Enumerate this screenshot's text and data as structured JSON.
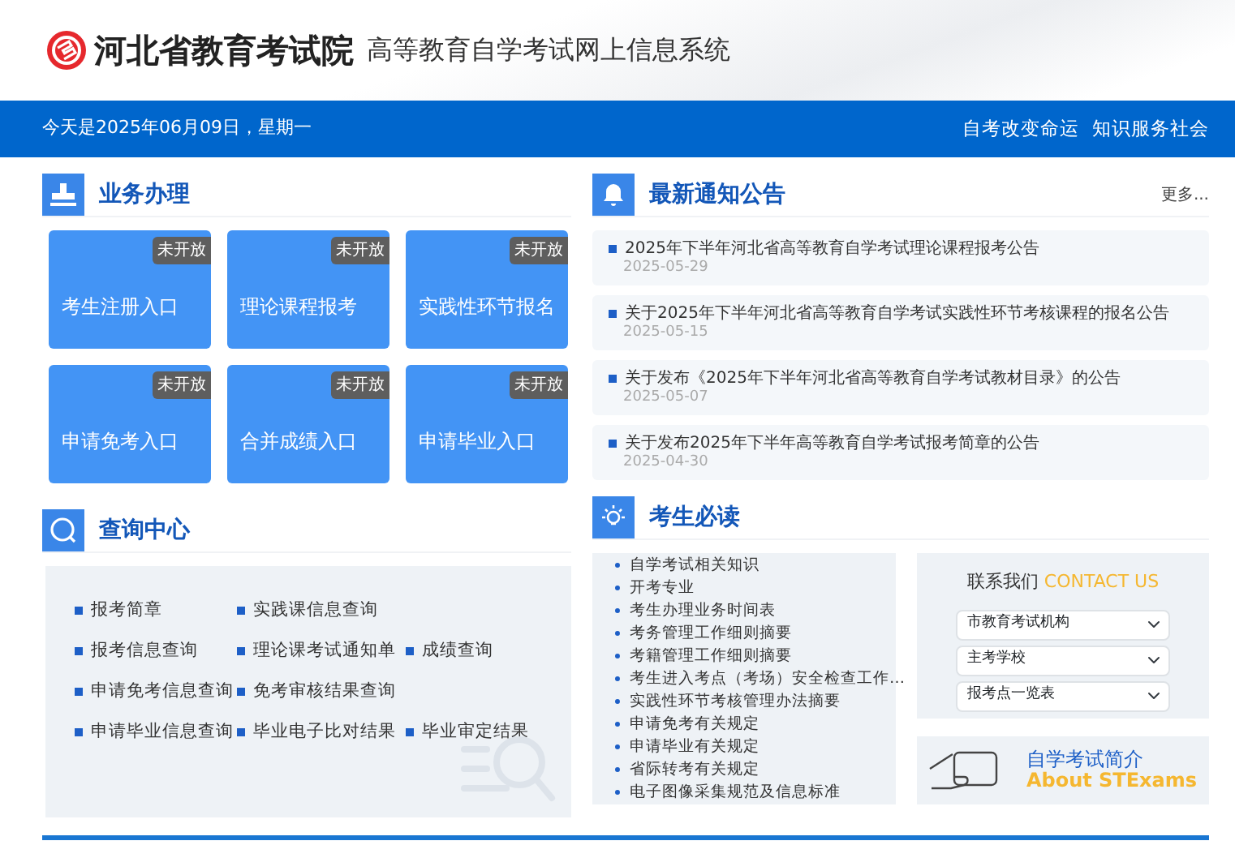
{
  "header": {
    "org_name": "河北省教育考试院",
    "system_name": "高等教育自学考试网上信息系统"
  },
  "top_bar": {
    "date_text": "今天是2025年06月09日，星期一",
    "links": [
      "自考改变命运",
      "知识服务社会"
    ]
  },
  "business": {
    "title": "业务办理",
    "tiles": [
      {
        "label": "考生注册入口",
        "badge": "未开放"
      },
      {
        "label": "理论课程报考",
        "badge": "未开放"
      },
      {
        "label": "实践性环节报名",
        "badge": "未开放"
      },
      {
        "label": "申请免考入口",
        "badge": "未开放"
      },
      {
        "label": "合并成绩入口",
        "badge": "未开放"
      },
      {
        "label": "申请毕业入口",
        "badge": "未开放"
      }
    ]
  },
  "notices": {
    "title": "最新通知公告",
    "more": "更多...",
    "items": [
      {
        "title": "2025年下半年河北省高等教育自学考试理论课程报考公告",
        "date": "2025-05-29"
      },
      {
        "title": "关于2025年下半年河北省高等教育自学考试实践性环节考核课程的报名公告",
        "date": "2025-05-15"
      },
      {
        "title": "关于发布《2025年下半年河北省高等教育自学考试教材目录》的公告",
        "date": "2025-05-07"
      },
      {
        "title": "关于发布2025年下半年高等教育自学考试报考简章的公告",
        "date": "2025-04-30"
      }
    ]
  },
  "query_center": {
    "title": "查询中心",
    "rows": [
      [
        "报考简章",
        "实践课信息查询"
      ],
      [
        "报考信息查询",
        "理论课考试通知单",
        "成绩查询"
      ],
      [
        "申请免考信息查询",
        "免考审核结果查询"
      ],
      [
        "申请毕业信息查询",
        "毕业电子比对结果",
        "毕业审定结果"
      ]
    ]
  },
  "must_read": {
    "title": "考生必读",
    "items": [
      "自学考试相关知识",
      "开考专业",
      "考生办理业务时间表",
      "考务管理工作细则摘要",
      "考籍管理工作细则摘要",
      "考生进入考点（考场）安全检查工作…",
      "实践性环节考核管理办法摘要",
      "申请免考有关规定",
      "申请毕业有关规定",
      "省际转考有关规定",
      "电子图像采集规范及信息标准"
    ]
  },
  "contact": {
    "title": "联系我们",
    "title_en": "CONTACT US",
    "selects": [
      {
        "value": "市教育考试机构"
      },
      {
        "value": "主考学校"
      },
      {
        "value": "报考点一览表"
      }
    ]
  },
  "intro": {
    "title": "自学考试简介",
    "title_en": "About STExams"
  }
}
